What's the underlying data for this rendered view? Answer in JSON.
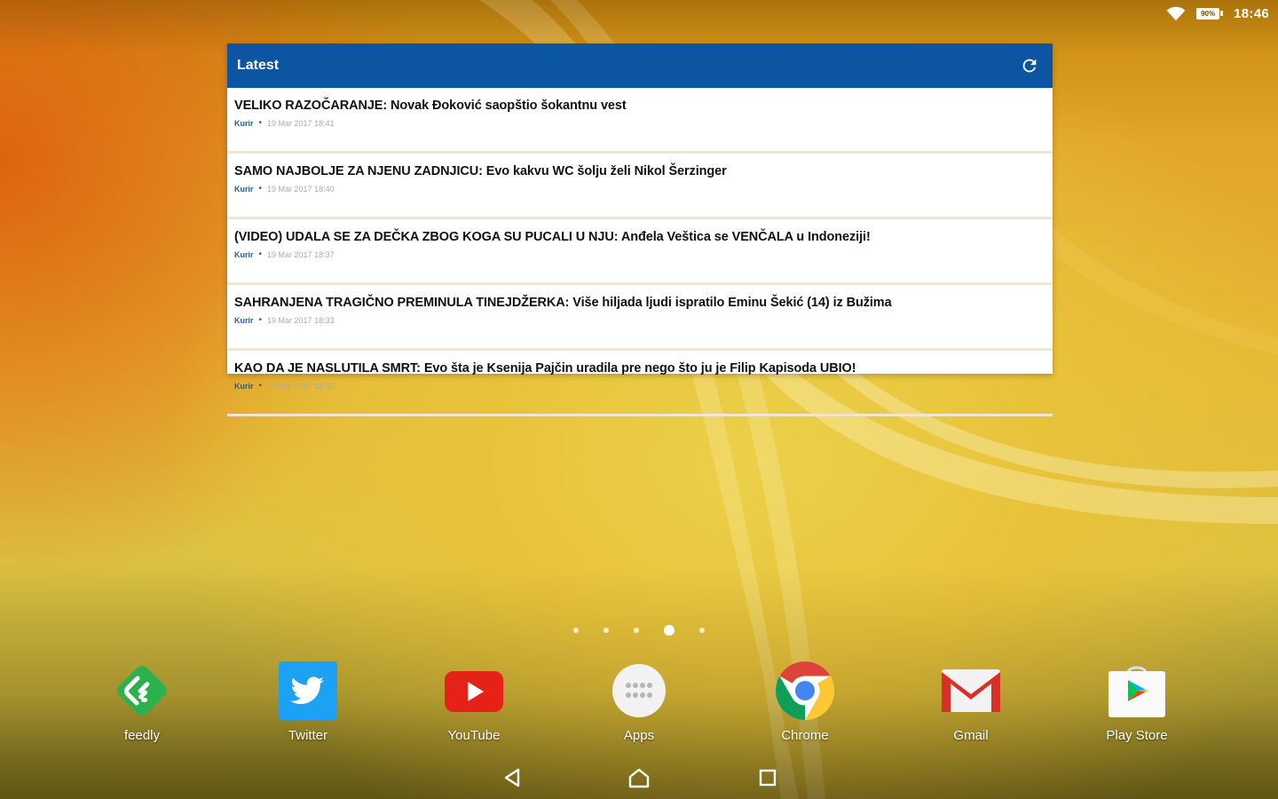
{
  "status_bar": {
    "battery_level": "90%",
    "time": "18:46",
    "icons": [
      "wifi-icon",
      "battery-icon"
    ]
  },
  "widget": {
    "title": "Latest",
    "refresh_icon": "refresh-icon",
    "header_color": "#0b55a3",
    "items": [
      {
        "title": "VELIKO RAZOČARANJE: Novak Đoković saopštio šokantnu vest",
        "source": "Kurir",
        "time": "19 Mar 2017 18:41"
      },
      {
        "title": "SAMO NAJBOLJE ZA NJENU ZADNJICU: Evo kakvu WC šolju želi Nikol Šerzinger",
        "source": "Kurir",
        "time": "19 Mar 2017 18:40"
      },
      {
        "title": "(VIDEO) UDALA SE ZA DEČKA ZBOG KOGA SU PUCALI U NJU: Anđela Veštica se VENČALA u Indoneziji!",
        "source": "Kurir",
        "time": "19 Mar 2017 18:37"
      },
      {
        "title": "SAHRANJENA TRAGIČNO PREMINULA TINEJDŽERKA: Više hiljada ljudi ispratilo Eminu Šekić (14) iz Bužima",
        "source": "Kurir",
        "time": "19 Mar 2017 18:33"
      },
      {
        "title": "KAO DA JE NASLUTILA SMRT: Evo šta je Ksenija Pajčin uradila pre nego što ju je Filip Kapisoda UBIO!",
        "source": "Kurir",
        "time": "19 Mar 2017 18:32"
      }
    ]
  },
  "page_indicator": {
    "count": 5,
    "active_index": 3
  },
  "dock": {
    "apps": [
      {
        "label": "feedly",
        "icon": "feedly-icon",
        "color": "#2bb24c"
      },
      {
        "label": "Twitter",
        "icon": "twitter-icon",
        "color": "#1da1f2"
      },
      {
        "label": "YouTube",
        "icon": "youtube-icon",
        "color": "#e62117"
      },
      {
        "label": "Apps",
        "icon": "app-drawer-icon",
        "color": "#f2f2f2"
      },
      {
        "label": "Chrome",
        "icon": "chrome-icon",
        "color": "#4285f4"
      },
      {
        "label": "Gmail",
        "icon": "gmail-icon",
        "color": "#d93025"
      },
      {
        "label": "Play Store",
        "icon": "play-store-icon",
        "color": "#ffffff"
      }
    ]
  },
  "nav_bar": {
    "buttons": [
      "back-icon",
      "home-icon",
      "recents-icon"
    ]
  }
}
